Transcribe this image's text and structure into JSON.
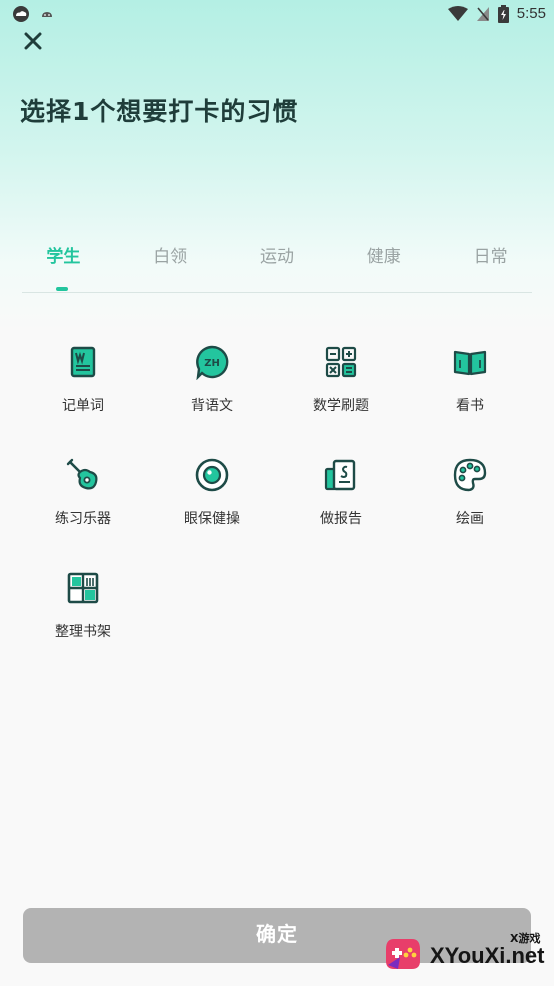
{
  "status_bar": {
    "time": "5:55",
    "left_icons": [
      "cloud-app-icon",
      "notification-icon"
    ],
    "right_icons": [
      "wifi-icon",
      "no-sim-icon",
      "battery-icon"
    ]
  },
  "header": {
    "close_icon": "close-icon",
    "title": "选择1个想要打卡的习惯"
  },
  "tabs": [
    {
      "label": "学生",
      "active": true
    },
    {
      "label": "白领",
      "active": false
    },
    {
      "label": "运动",
      "active": false
    },
    {
      "label": "健康",
      "active": false
    },
    {
      "label": "日常",
      "active": false
    }
  ],
  "habits": [
    {
      "label": "记单词",
      "icon": "word-book-icon"
    },
    {
      "label": "背语文",
      "icon": "zh-speech-icon"
    },
    {
      "label": "数学刷题",
      "icon": "calculator-icon"
    },
    {
      "label": "看书",
      "icon": "open-book-icon"
    },
    {
      "label": "练习乐器",
      "icon": "guitar-icon"
    },
    {
      "label": "眼保健操",
      "icon": "eye-icon"
    },
    {
      "label": "做报告",
      "icon": "report-icon"
    },
    {
      "label": "绘画",
      "icon": "palette-icon"
    },
    {
      "label": "整理书架",
      "icon": "bookshelf-icon"
    }
  ],
  "footer": {
    "confirm_label": "确定"
  },
  "watermark": {
    "text": "XYouXi.net",
    "small_text": "X游戏"
  },
  "colors": {
    "accent": "#23c59e",
    "icon_dark": "#1e4b47",
    "button_disabled": "#b3b3b3"
  }
}
